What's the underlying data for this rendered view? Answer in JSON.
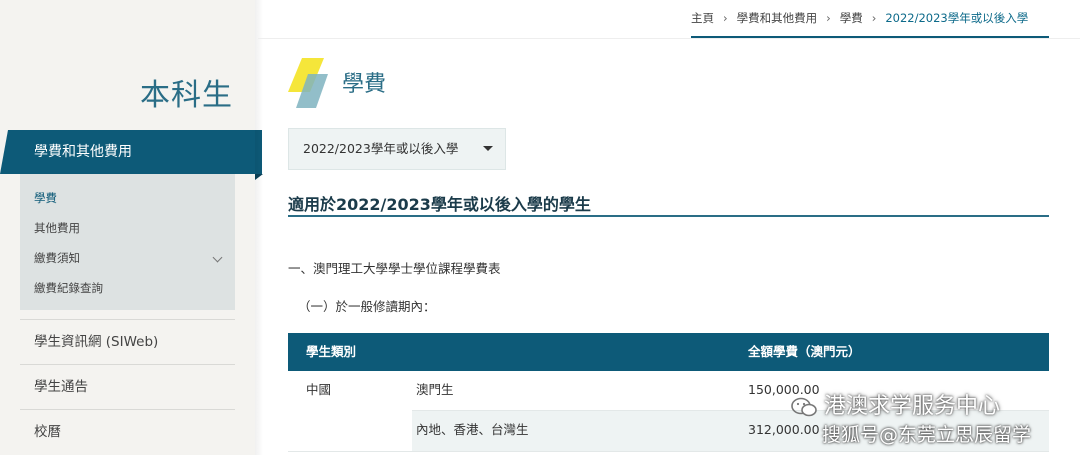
{
  "sidebar": {
    "title": "本科生",
    "active_section": "學費和其他費用",
    "submenu": [
      {
        "label": "學費"
      },
      {
        "label": "其他費用"
      },
      {
        "label": "繳費須知"
      },
      {
        "label": "繳費紀錄查詢"
      }
    ],
    "links": [
      {
        "label": "學生資訊網 (SIWeb)"
      },
      {
        "label": "學生通告"
      },
      {
        "label": "校曆"
      }
    ]
  },
  "breadcrumb": {
    "home": "主頁",
    "level1": "學費和其他費用",
    "level2": "學費",
    "current": "2022/2023學年或以後入學",
    "separator": "›"
  },
  "header": {
    "title": "學費"
  },
  "dropdown": {
    "selected": "2022/2023學年或以後入學"
  },
  "content": {
    "heading": "適用於2022/2023學年或以後入學的學生",
    "para1": "一、澳門理工大學學士學位課程學費表",
    "para2": "（一）於一般修讀期內："
  },
  "table": {
    "headers": [
      "學生類別",
      "全額學費（澳門元）"
    ],
    "rows": [
      {
        "region": "中國",
        "category": "澳門生",
        "fee": "150,000.00"
      },
      {
        "region": "",
        "category": "內地、香港、台灣生",
        "fee": "312,000.00"
      }
    ]
  },
  "watermark": {
    "line1": "港澳求学服务中心",
    "line2": "搜狐号@东莞立思辰留学"
  },
  "colors": {
    "primary": "#0d5a78",
    "title": "#2a6d86",
    "sidebar_bg": "#f4f3f0",
    "accent_yellow": "#f5e63a"
  }
}
